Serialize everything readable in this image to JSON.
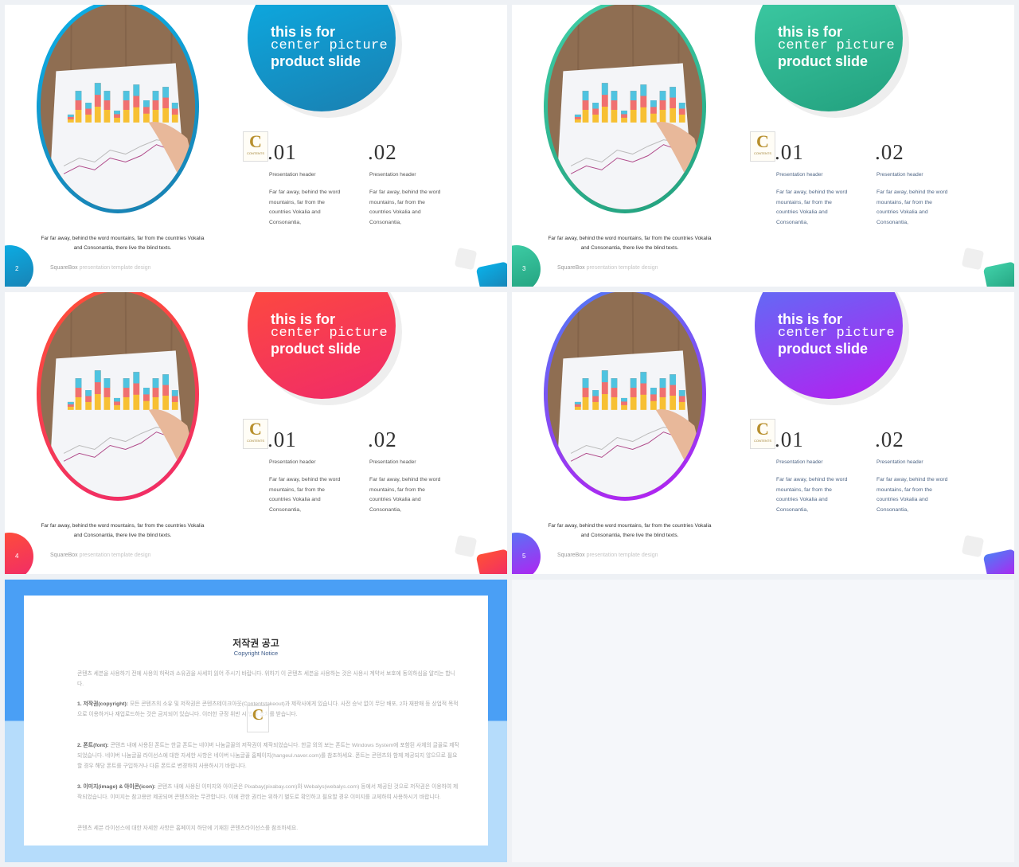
{
  "slides": [
    {
      "page": "2",
      "color1": "#0ab0e8",
      "color2": "#1a7fb0",
      "text_style": "dark"
    },
    {
      "page": "3",
      "color1": "#40d0a8",
      "color2": "#22a07e",
      "text_style": "blue"
    },
    {
      "page": "4",
      "color1": "#ff5036",
      "color2": "#f02a6a",
      "text_style": "dark"
    },
    {
      "page": "5",
      "color1": "#4f7cf6",
      "color2": "#b81cf0",
      "text_style": "blue"
    }
  ],
  "slide_text": {
    "title_line1": "this is for",
    "title_line2": "center picture",
    "title_line3": "product slide",
    "logo_letter": "C",
    "logo_sub": "CONTENTS",
    "items": [
      {
        "number": ".01",
        "header": "Presentation header",
        "body": "Far far away, behind the word mountains, far from the countries Vokalia and Consonantia,"
      },
      {
        "number": ".02",
        "header": "Presentation header",
        "body": "Far far away, behind the word mountains, far from the countries Vokalia and Consonantia,"
      }
    ],
    "caption": "Far far away, behind the word mountains, far from the countries Vokalia and Consonantia, there live the blind texts.",
    "footer_brand": "SquareBox",
    "footer_text": " presentation template design"
  },
  "copyright": {
    "title": "저작권 공고",
    "subtitle": "Copyright Notice",
    "intro": "콘텐츠 세븐을 사용하기 전에 사용의 허락과 소유권을 사세히 읽어 주시기 바랍니다. 위하기 이 콘텐츠 세븐을 사용하는 것은 사용시 계약서 보호에 동의하심을 알리는 합니다.",
    "sections": [
      {
        "label": "1. 저작권(copyright):",
        "text": " 모든 콘텐츠의 소유 및 저작권은 콘텐츠테이크아웃(Contentstakeout)과 제작사에게 있습니다. 사전 승낙 없이 무단 배포, 2차 재판매 등 상업적 목적으로 이용하거나 재업로드하는 것은 금지되어 있습니다. 이러한 규정 위반 시 법적 조치를 받습니다."
      },
      {
        "label": "2. 폰트(font):",
        "text": " 콘텐츠 내에 사용된 폰트는 한글 폰트는 네이버 나눔글꼴의 저작권이 제작되었습니다. 한글 외의 보는 폰트는 Windows System에 포함된 사체의 글꼴로 제작되었습니다. 네이버 나눔글꼴 라이선스에 대한 자세한 사항은 네이버 나눔글꼴 홈페이지(hangeul.naver.com)를 참조하세요. 폰트는 콘텐츠와 함께 제공되지 않으므로 필요할 경우 해당 폰트를 구입하거나 다른 폰트로 변경하여 사용하시기 바랍니다."
      },
      {
        "label": "3. 이미지(image) & 아이콘(icon):",
        "text": " 콘텐츠 내에 사용된 이미지와 아이콘은 Pixabay(pixabay.com)와 Webalys(webalys.com) 등에서 제공된 것으로 저작권은 이용하여 제작되었습니다. 이미지는 참고용만 제공되며 콘텐츠와는 무관합니다. 이에 관한 권리는 위하기 별도로 확인하고 필요할 경우 이미지를 교체하여 사용하시기 바랍니다."
      }
    ],
    "closing": "콘텐츠 세븐 라이선스에 대한 자세한 사항은 홈페이지 하단에 기재된 콘텐츠라이선스를 참조하세요."
  },
  "colors": {
    "copyright_top": "#4a9ff5",
    "copyright_bottom": "#b5dcfb",
    "gold": "#b8902e"
  }
}
